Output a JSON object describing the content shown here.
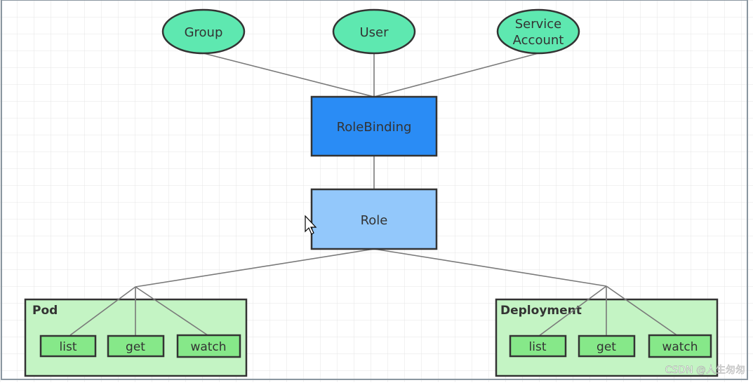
{
  "subjects": [
    {
      "label": "Group"
    },
    {
      "label": "User"
    },
    {
      "label_lines": [
        "Service",
        "Account"
      ]
    }
  ],
  "rolebinding": {
    "label": "RoleBinding"
  },
  "role": {
    "label": "Role"
  },
  "resources": [
    {
      "label": "Pod",
      "verbs": [
        "list",
        "get",
        "watch"
      ]
    },
    {
      "label": "Deployment",
      "verbs": [
        "list",
        "get",
        "watch"
      ]
    }
  ],
  "watermark": "CSDN @人生匆匆",
  "colors": {
    "subject_fill": "#5ee8b0",
    "rolebinding_fill": "#2a8cf5",
    "role_fill": "#93c8fb",
    "resource_fill": "#c4f4c4",
    "verb_fill": "#86e889",
    "grid": "#e4e4e4"
  }
}
